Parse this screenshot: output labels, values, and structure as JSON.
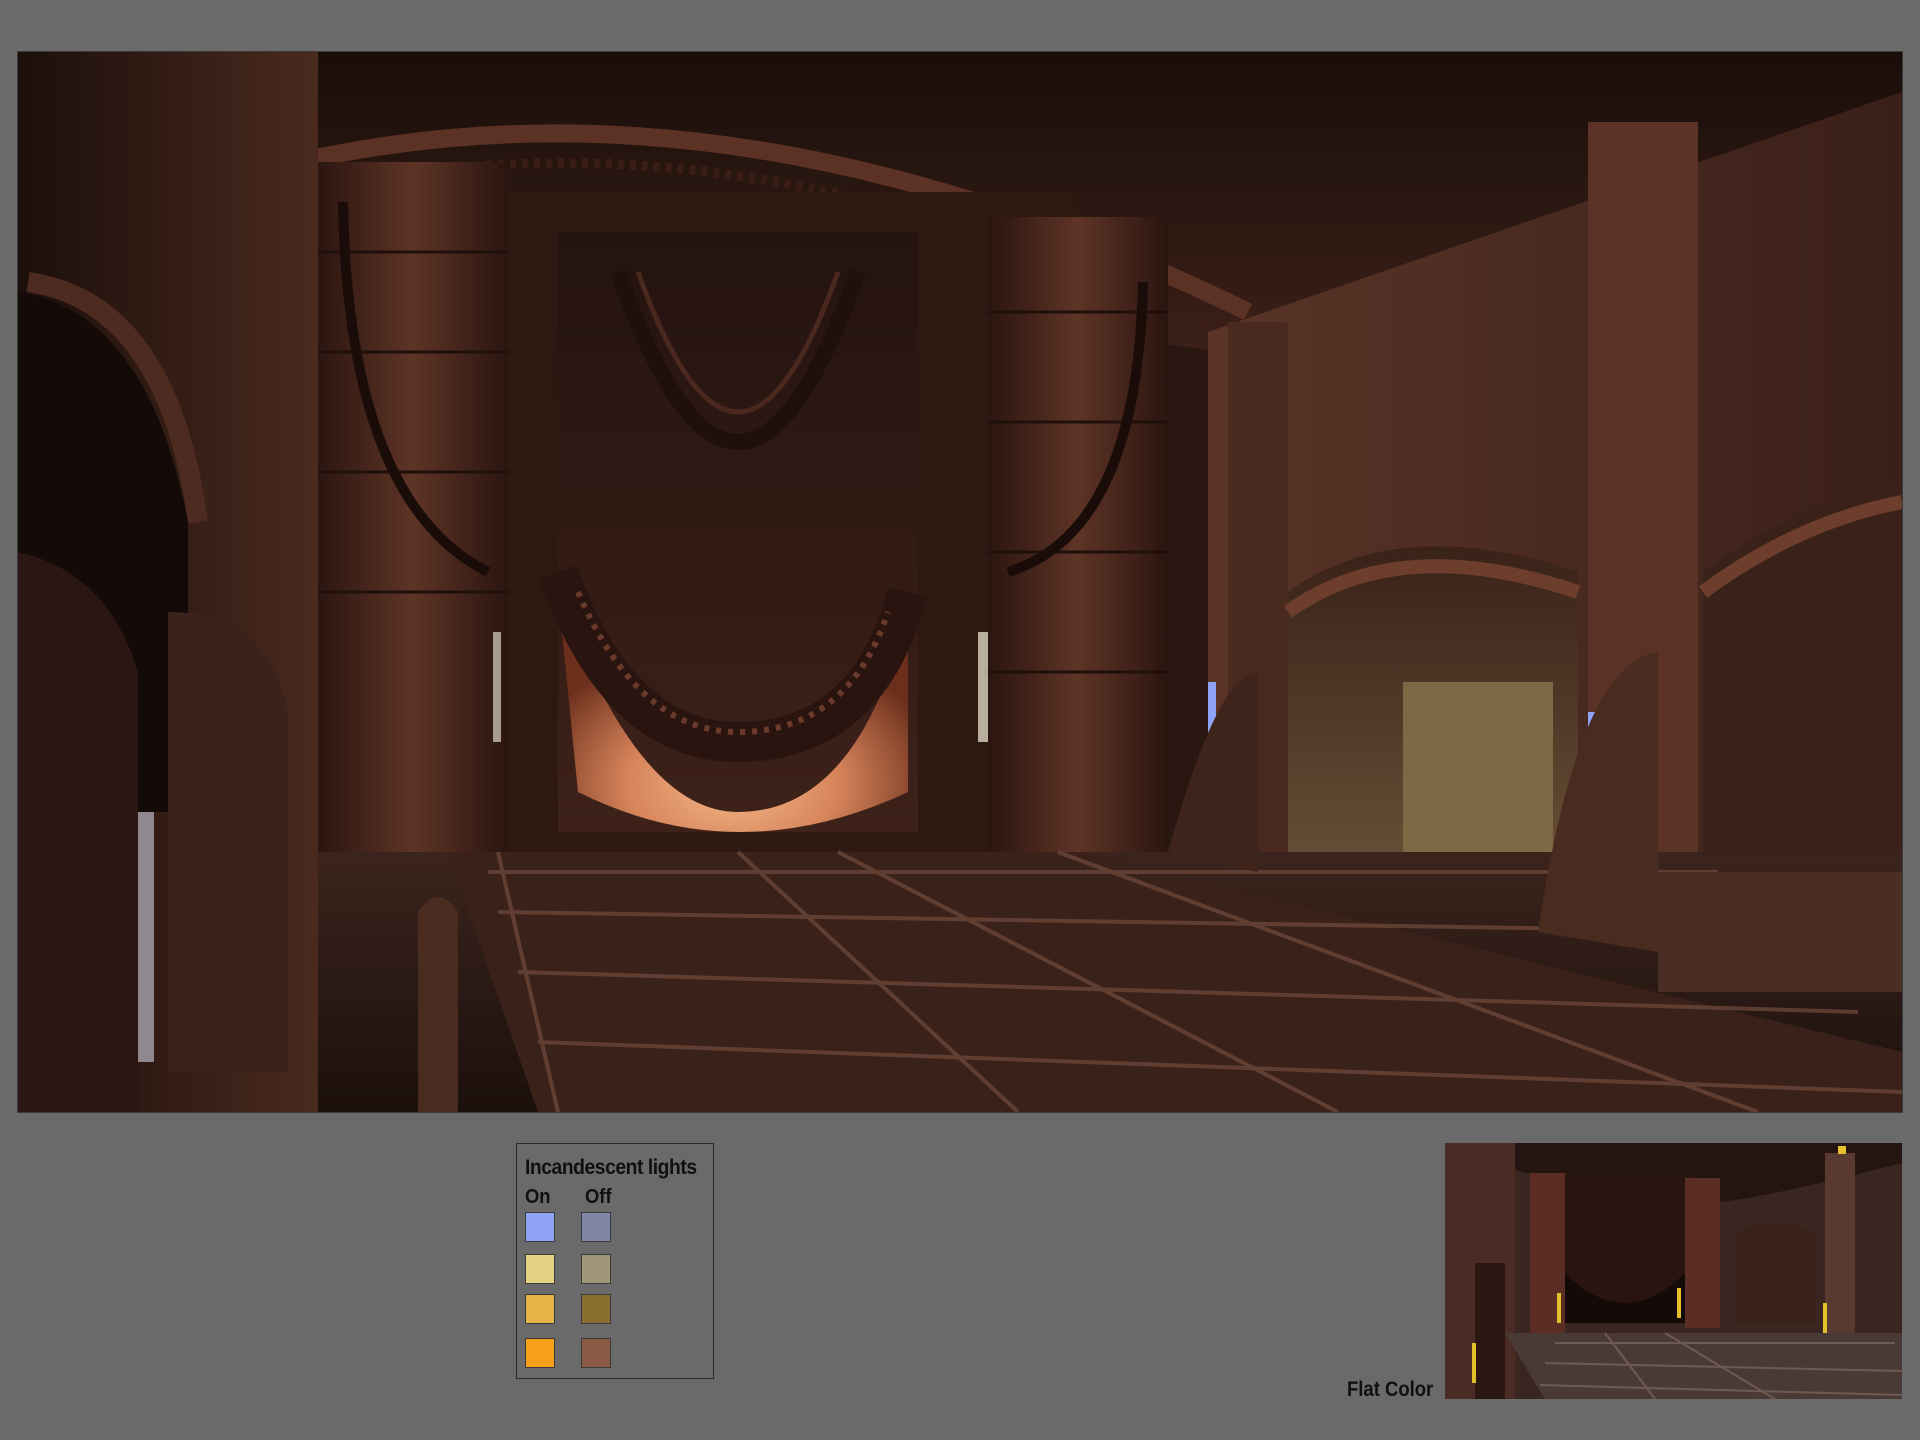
{
  "legend": {
    "title": "Incandescent lights",
    "on_label": "On",
    "off_label": "Off",
    "swatches": [
      {
        "on": "#8fa3f5",
        "off": "#7f86a6"
      },
      {
        "on": "#e4d382",
        "off": "#9f9677"
      },
      {
        "on": "#e6b448",
        "off": "#8a7030"
      },
      {
        "on": "#f8a01a",
        "off": "#8a5a45"
      }
    ]
  },
  "flat_color": {
    "label": "Flat Color"
  },
  "colors": {
    "background": "#6a6a6a",
    "rust_dark": "#2a1712",
    "rust_mid": "#5a3022",
    "glow": "#e79a6a"
  }
}
